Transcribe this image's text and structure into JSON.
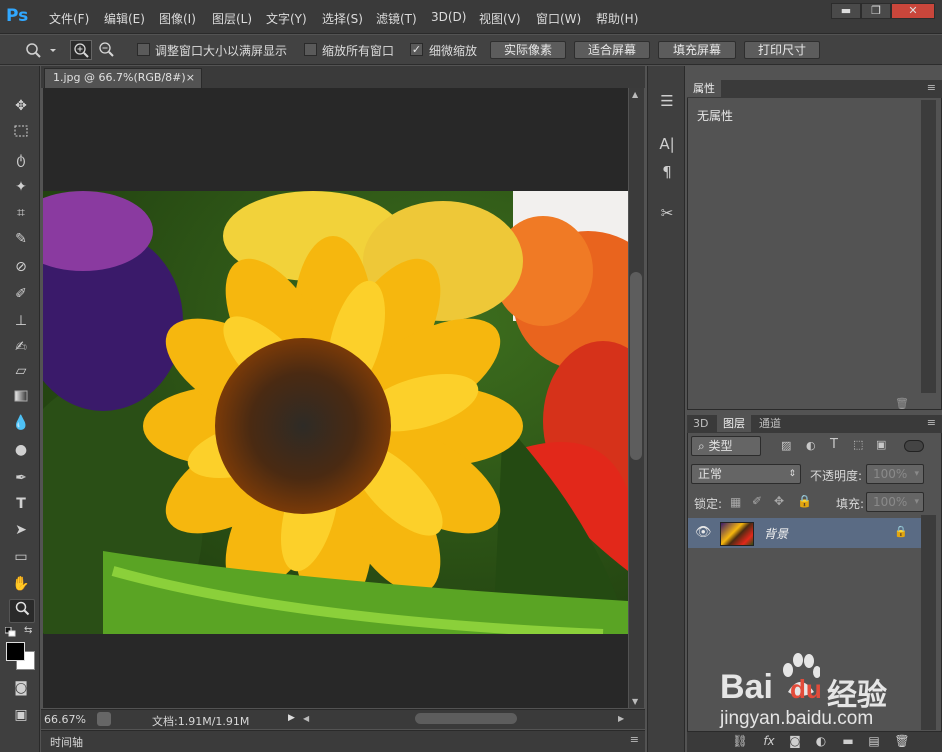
{
  "app": {
    "logo": "Ps"
  },
  "menu": [
    "文件(F)",
    "编辑(E)",
    "图像(I)",
    "图层(L)",
    "文字(Y)",
    "选择(S)",
    "滤镜(T)",
    "3D(D)",
    "视图(V)",
    "窗口(W)",
    "帮助(H)"
  ],
  "window_controls": {
    "minimize": "▬",
    "restore": "❐",
    "close": "✕"
  },
  "options": {
    "resize_windows_label": "调整窗口大小以满屏显示",
    "resize_windows_checked": false,
    "zoom_all_label": "缩放所有窗口",
    "zoom_all_checked": false,
    "scrubby_zoom_label": "细微缩放",
    "scrubby_zoom_checked": true,
    "buttons": [
      "实际像素",
      "适合屏幕",
      "填充屏幕",
      "打印尺寸"
    ],
    "checkmark": "✓"
  },
  "document": {
    "tab_title": "1.jpg @ 66.7%(RGB/8#)",
    "tab_close": "×",
    "zoom": "66.67%",
    "doc_size": "文档:1.91M/1.91M"
  },
  "timeline": {
    "label": "时间轴"
  },
  "properties": {
    "tab": "属性",
    "content": "无属性"
  },
  "layers_panel": {
    "tabs": [
      "3D",
      "图层",
      "通道"
    ],
    "active_tab": "图层",
    "filter_kind": "类型",
    "blend_mode": "正常",
    "opacity_label": "不透明度:",
    "opacity_value": "100%",
    "lock_label": "锁定:",
    "fill_label": "填充:",
    "fill_value": "100%",
    "layers": [
      {
        "name": "背景",
        "visible": true,
        "locked": true
      }
    ]
  },
  "watermark": {
    "brand": "Bai",
    "brand2": "du",
    "sub": "经验",
    "url": "jingyan.baidu.com"
  },
  "colors": {
    "accent": "#31a8ff",
    "selected_layer": "#5a6b84",
    "panel": "#535353",
    "chrome": "#3a3a3a"
  }
}
